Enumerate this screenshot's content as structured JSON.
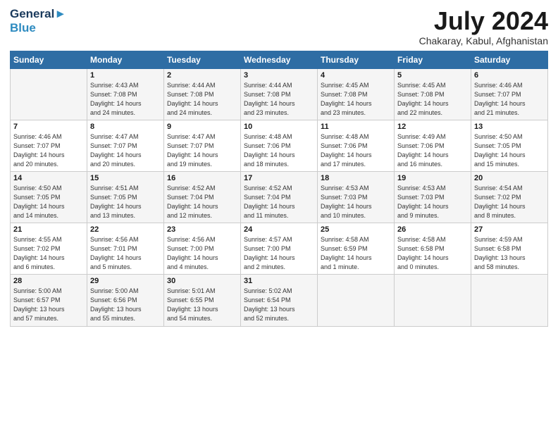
{
  "header": {
    "logo_line1": "General",
    "logo_line2": "Blue",
    "month_year": "July 2024",
    "location": "Chakaray, Kabul, Afghanistan"
  },
  "weekdays": [
    "Sunday",
    "Monday",
    "Tuesday",
    "Wednesday",
    "Thursday",
    "Friday",
    "Saturday"
  ],
  "weeks": [
    [
      {
        "day": "",
        "info": ""
      },
      {
        "day": "1",
        "info": "Sunrise: 4:43 AM\nSunset: 7:08 PM\nDaylight: 14 hours\nand 24 minutes."
      },
      {
        "day": "2",
        "info": "Sunrise: 4:44 AM\nSunset: 7:08 PM\nDaylight: 14 hours\nand 24 minutes."
      },
      {
        "day": "3",
        "info": "Sunrise: 4:44 AM\nSunset: 7:08 PM\nDaylight: 14 hours\nand 23 minutes."
      },
      {
        "day": "4",
        "info": "Sunrise: 4:45 AM\nSunset: 7:08 PM\nDaylight: 14 hours\nand 23 minutes."
      },
      {
        "day": "5",
        "info": "Sunrise: 4:45 AM\nSunset: 7:08 PM\nDaylight: 14 hours\nand 22 minutes."
      },
      {
        "day": "6",
        "info": "Sunrise: 4:46 AM\nSunset: 7:07 PM\nDaylight: 14 hours\nand 21 minutes."
      }
    ],
    [
      {
        "day": "7",
        "info": "Sunrise: 4:46 AM\nSunset: 7:07 PM\nDaylight: 14 hours\nand 20 minutes."
      },
      {
        "day": "8",
        "info": "Sunrise: 4:47 AM\nSunset: 7:07 PM\nDaylight: 14 hours\nand 20 minutes."
      },
      {
        "day": "9",
        "info": "Sunrise: 4:47 AM\nSunset: 7:07 PM\nDaylight: 14 hours\nand 19 minutes."
      },
      {
        "day": "10",
        "info": "Sunrise: 4:48 AM\nSunset: 7:06 PM\nDaylight: 14 hours\nand 18 minutes."
      },
      {
        "day": "11",
        "info": "Sunrise: 4:48 AM\nSunset: 7:06 PM\nDaylight: 14 hours\nand 17 minutes."
      },
      {
        "day": "12",
        "info": "Sunrise: 4:49 AM\nSunset: 7:06 PM\nDaylight: 14 hours\nand 16 minutes."
      },
      {
        "day": "13",
        "info": "Sunrise: 4:50 AM\nSunset: 7:05 PM\nDaylight: 14 hours\nand 15 minutes."
      }
    ],
    [
      {
        "day": "14",
        "info": "Sunrise: 4:50 AM\nSunset: 7:05 PM\nDaylight: 14 hours\nand 14 minutes."
      },
      {
        "day": "15",
        "info": "Sunrise: 4:51 AM\nSunset: 7:05 PM\nDaylight: 14 hours\nand 13 minutes."
      },
      {
        "day": "16",
        "info": "Sunrise: 4:52 AM\nSunset: 7:04 PM\nDaylight: 14 hours\nand 12 minutes."
      },
      {
        "day": "17",
        "info": "Sunrise: 4:52 AM\nSunset: 7:04 PM\nDaylight: 14 hours\nand 11 minutes."
      },
      {
        "day": "18",
        "info": "Sunrise: 4:53 AM\nSunset: 7:03 PM\nDaylight: 14 hours\nand 10 minutes."
      },
      {
        "day": "19",
        "info": "Sunrise: 4:53 AM\nSunset: 7:03 PM\nDaylight: 14 hours\nand 9 minutes."
      },
      {
        "day": "20",
        "info": "Sunrise: 4:54 AM\nSunset: 7:02 PM\nDaylight: 14 hours\nand 8 minutes."
      }
    ],
    [
      {
        "day": "21",
        "info": "Sunrise: 4:55 AM\nSunset: 7:02 PM\nDaylight: 14 hours\nand 6 minutes."
      },
      {
        "day": "22",
        "info": "Sunrise: 4:56 AM\nSunset: 7:01 PM\nDaylight: 14 hours\nand 5 minutes."
      },
      {
        "day": "23",
        "info": "Sunrise: 4:56 AM\nSunset: 7:00 PM\nDaylight: 14 hours\nand 4 minutes."
      },
      {
        "day": "24",
        "info": "Sunrise: 4:57 AM\nSunset: 7:00 PM\nDaylight: 14 hours\nand 2 minutes."
      },
      {
        "day": "25",
        "info": "Sunrise: 4:58 AM\nSunset: 6:59 PM\nDaylight: 14 hours\nand 1 minute."
      },
      {
        "day": "26",
        "info": "Sunrise: 4:58 AM\nSunset: 6:58 PM\nDaylight: 14 hours\nand 0 minutes."
      },
      {
        "day": "27",
        "info": "Sunrise: 4:59 AM\nSunset: 6:58 PM\nDaylight: 13 hours\nand 58 minutes."
      }
    ],
    [
      {
        "day": "28",
        "info": "Sunrise: 5:00 AM\nSunset: 6:57 PM\nDaylight: 13 hours\nand 57 minutes."
      },
      {
        "day": "29",
        "info": "Sunrise: 5:00 AM\nSunset: 6:56 PM\nDaylight: 13 hours\nand 55 minutes."
      },
      {
        "day": "30",
        "info": "Sunrise: 5:01 AM\nSunset: 6:55 PM\nDaylight: 13 hours\nand 54 minutes."
      },
      {
        "day": "31",
        "info": "Sunrise: 5:02 AM\nSunset: 6:54 PM\nDaylight: 13 hours\nand 52 minutes."
      },
      {
        "day": "",
        "info": ""
      },
      {
        "day": "",
        "info": ""
      },
      {
        "day": "",
        "info": ""
      }
    ]
  ]
}
